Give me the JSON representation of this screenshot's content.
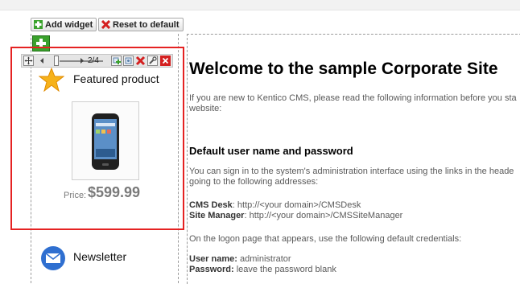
{
  "toolbar": {
    "add_widget_label": "Add widget",
    "reset_label": "Reset to default"
  },
  "widget_toolbar": {
    "pager": "2/4"
  },
  "featured_product": {
    "title": "Featured product",
    "price_label": "Price:",
    "price_value": "$599.99"
  },
  "newsletter": {
    "title": "Newsletter"
  },
  "content": {
    "heading": "Welcome to the sample Corporate Site",
    "intro_line1": "If you are new to Kentico CMS, please read the following information before you sta",
    "intro_line2": "website:",
    "subheading": "Default user name and password",
    "signin_line1": "You can sign in to the system's administration interface using the links in the heade",
    "signin_line2": "going to the following addresses:",
    "cms_desk_label": "CMS Desk",
    "cms_desk_url": ": http://<your domain>/CMSDesk",
    "site_manager_label": "Site Manager",
    "site_manager_url": ": http://<your domain>/CMSSiteManager",
    "logon_text": "On the logon page that appears, use the following default credentials:",
    "username_label": "User name:",
    "username_value": " administrator",
    "password_label": "Password:",
    "password_value": " leave the password blank"
  },
  "colors": {
    "highlight": "#e52222",
    "add_green": "#3aa22c",
    "reset_red": "#d42020"
  }
}
